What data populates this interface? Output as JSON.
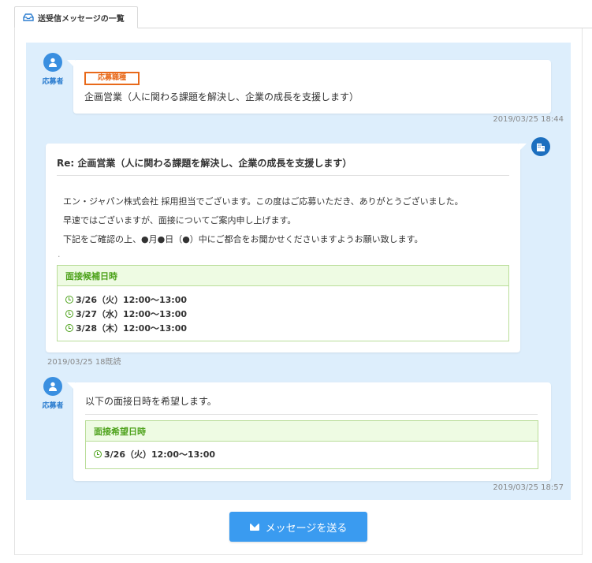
{
  "tab": {
    "label": "送受信メッセージの一覧"
  },
  "roles": {
    "applicant": "応募者"
  },
  "messages": [
    {
      "tag": "応募職種",
      "text": "企画営業（人に関わる課題を解決し、企業の成長を支援します）",
      "timestamp": "2019/03/25 18:44"
    },
    {
      "subject": "Re: 企画営業（人に関わる課題を解決し、企業の成長を支援します）",
      "body": [
        "エン・ジャパン株式会社 採用担当でございます。この度はご応募いただき、ありがとうございました。",
        "早速ではございますが、面接についてご案内申し上げます。",
        "下記をご確認の上、●月●日（●）中にご都合をお聞かせくださいますようお願い致します。"
      ],
      "dot": ".",
      "slots_title": "面接候補日時",
      "slots": [
        "3/26（火）12:00〜13:00",
        "3/27（水）12:00〜13:00",
        "3/28（木）12:00〜13:00"
      ],
      "timestamp": "2019/03/25 18既読"
    },
    {
      "text": "以下の面接日時を希望します。",
      "slots_title": "面接希望日時",
      "slots": [
        "3/26（火）12:00〜13:00"
      ],
      "timestamp": "2019/03/25 18:57"
    }
  ],
  "send_button": {
    "label": "メッセージを送る"
  },
  "colors": {
    "accent": "#3a9bf0",
    "thread_bg": "#ddeefc",
    "tag": "#e8691a",
    "slot_green": "#4da21b"
  }
}
